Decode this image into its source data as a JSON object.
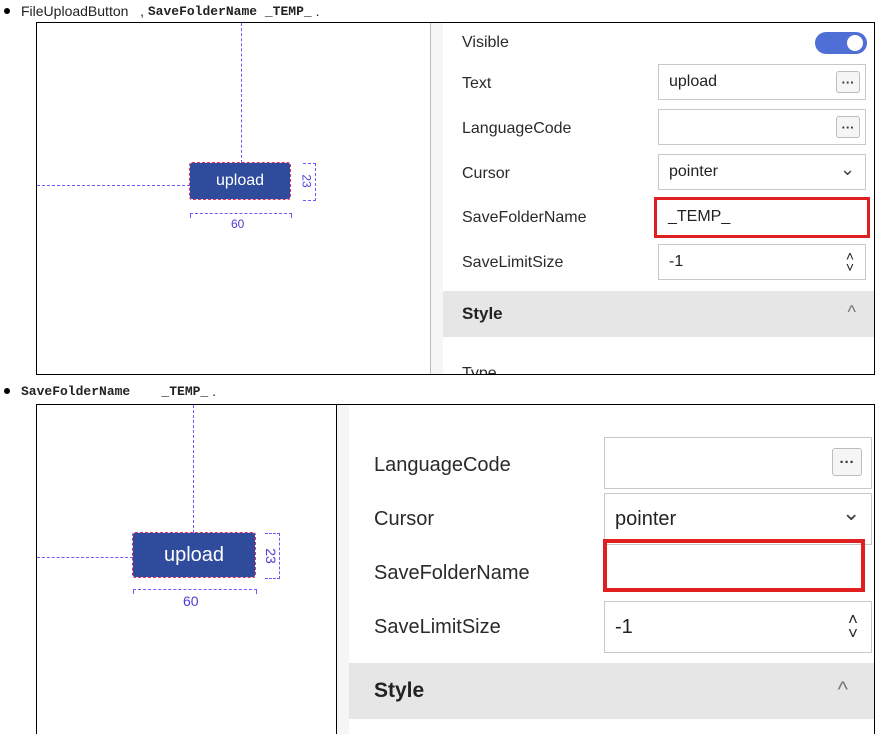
{
  "line1": {
    "plain": "FileUploadButton   , ",
    "code": "SaveFolderName _TEMP_",
    "tail": " ."
  },
  "line2": {
    "code": "SaveFolderName    _TEMP_",
    "tail": " ."
  },
  "panel1": {
    "button_label": "upload",
    "width_label": "60",
    "height_label": "23",
    "rows": {
      "visible": "Visible",
      "text": "Text",
      "text_value": "upload",
      "language": "LanguageCode",
      "language_value": "",
      "cursor": "Cursor",
      "cursor_value": "pointer",
      "savefolder": "SaveFolderName",
      "savefolder_value": "_TEMP_",
      "savelimit": "SaveLimitSize",
      "savelimit_value": "-1"
    },
    "ellipsis": "···",
    "section_title": "Style",
    "type_label": "Type"
  },
  "panel2": {
    "button_label": "upload",
    "width_label": "60",
    "height_label": "23",
    "rows": {
      "language": "LanguageCode",
      "language_value": "",
      "cursor": "Cursor",
      "cursor_value": "pointer",
      "savefolder": "SaveFolderName",
      "savefolder_value": "",
      "savelimit": "SaveLimitSize",
      "savelimit_value": "-1"
    },
    "ellipsis": "···",
    "section_title": "Style"
  },
  "icons": {
    "chevron_down": "⌄",
    "spin_up": "˄",
    "spin_down": "˅",
    "section_caret": "^"
  },
  "colors": {
    "button_bg": "#2f4b9c",
    "toggle_on": "#4f6fd6",
    "highlight": "#e02020",
    "guide": "#6a5cff"
  }
}
